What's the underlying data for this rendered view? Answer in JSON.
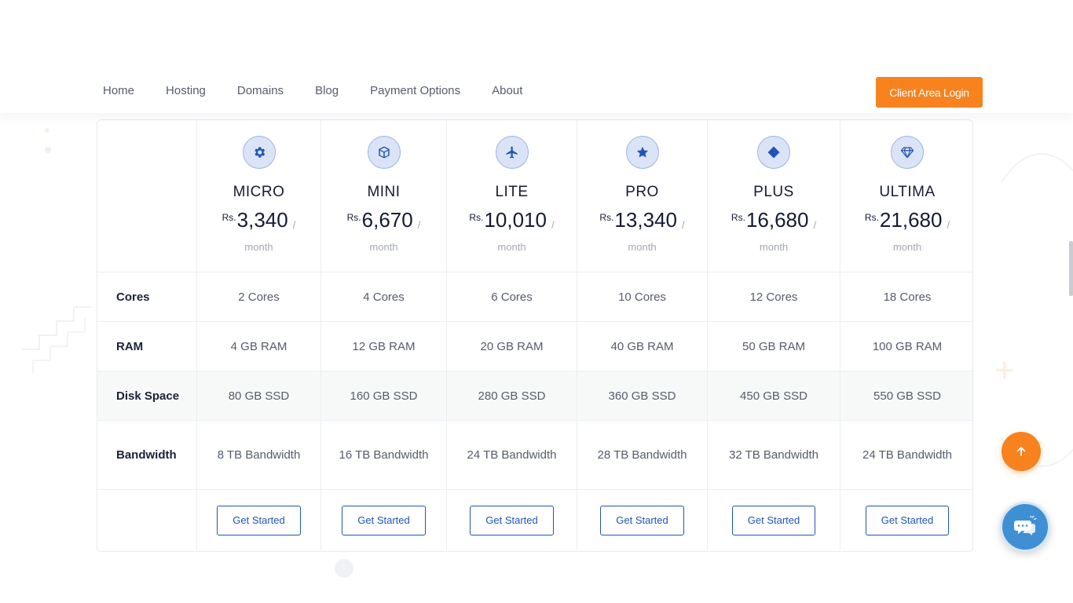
{
  "nav": {
    "links": [
      "Home",
      "Hosting",
      "Domains",
      "Blog",
      "Payment Options",
      "About"
    ],
    "login_label": "Client Area Login"
  },
  "colors": {
    "accent": "#f7821e",
    "primary": "#1f54b8",
    "chat": "#3f8fd4"
  },
  "pricing": {
    "currency": "Rs.",
    "separator": "/",
    "period": "month",
    "plans": [
      {
        "name": "MICRO",
        "icon": "gear-icon",
        "price": "3,340",
        "cores": "2 Cores",
        "ram": "4 GB RAM",
        "disk": "80 GB SSD",
        "bandwidth": "8 TB Bandwidth",
        "cta": "Get Started"
      },
      {
        "name": "MINI",
        "icon": "cube-icon",
        "price": "6,670",
        "cores": "4 Cores",
        "ram": "12 GB RAM",
        "disk": "160 GB SSD",
        "bandwidth": "16 TB Bandwidth",
        "cta": "Get Started"
      },
      {
        "name": "LITE",
        "icon": "plane-icon",
        "price": "10,010",
        "cores": "6 Cores",
        "ram": "20 GB RAM",
        "disk": "280 GB SSD",
        "bandwidth": "24 TB Bandwidth",
        "cta": "Get Started"
      },
      {
        "name": "PRO",
        "icon": "star-icon",
        "price": "13,340",
        "cores": "10 Cores",
        "ram": "40 GB RAM",
        "disk": "360 GB SSD",
        "bandwidth": "28 TB Bandwidth",
        "cta": "Get Started"
      },
      {
        "name": "PLUS",
        "icon": "diamond-icon",
        "price": "16,680",
        "cores": "12 Cores",
        "ram": "50 GB RAM",
        "disk": "450 GB SSD",
        "bandwidth": "32 TB Bandwidth",
        "cta": "Get Started"
      },
      {
        "name": "ULTIMA",
        "icon": "gem-icon",
        "price": "21,680",
        "cores": "18 Cores",
        "ram": "100 GB RAM",
        "disk": "550 GB SSD",
        "bandwidth": "24 TB Bandwidth",
        "cta": "Get Started"
      }
    ],
    "row_labels": {
      "cores": "Cores",
      "ram": "RAM",
      "disk": "Disk Space",
      "bandwidth": "Bandwidth"
    }
  },
  "floating": {
    "scroll_top_icon": "arrow-up-icon",
    "chat_icon": "chat-bubbles-icon"
  }
}
